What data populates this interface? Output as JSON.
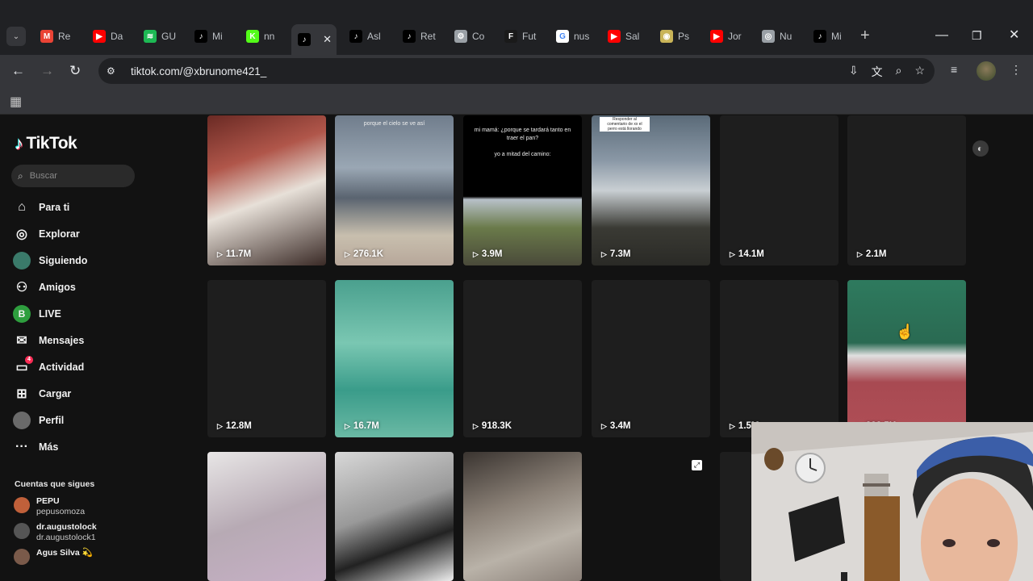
{
  "browser": {
    "tabs": [
      {
        "label": "Re",
        "icon": "gmail-icon",
        "color": "#ea4335",
        "glyph": "M"
      },
      {
        "label": "Da",
        "icon": "youtube-icon",
        "color": "#ff0000",
        "glyph": "▶"
      },
      {
        "label": "GU",
        "icon": "spotify-icon",
        "color": "#1db954",
        "glyph": "≋"
      },
      {
        "label": "Mi",
        "icon": "tiktok-icon",
        "color": "#000000",
        "glyph": "♪"
      },
      {
        "label": "nn",
        "icon": "kick-icon",
        "color": "#53fc18",
        "glyph": "K"
      },
      {
        "label": "",
        "icon": "tiktok-icon",
        "color": "#000000",
        "glyph": "♪",
        "active": true
      },
      {
        "label": "Asl",
        "icon": "tiktok-icon",
        "color": "#000000",
        "glyph": "♪"
      },
      {
        "label": "Ret",
        "icon": "tiktok-icon",
        "color": "#000000",
        "glyph": "♪"
      },
      {
        "label": "Co",
        "icon": "settings-icon",
        "color": "#9aa0a6",
        "glyph": "⚙"
      },
      {
        "label": "Fut",
        "icon": "fifa-icon",
        "color": "#1a1a1a",
        "glyph": "F"
      },
      {
        "label": "nus",
        "icon": "google-icon",
        "color": "#ffffff",
        "glyph": "G"
      },
      {
        "label": "Sal",
        "icon": "youtube-icon",
        "color": "#ff0000",
        "glyph": "▶"
      },
      {
        "label": "Ps",
        "icon": "pes-icon",
        "color": "#c9b458",
        "glyph": "◉"
      },
      {
        "label": "Jor",
        "icon": "youtube-icon",
        "color": "#ff0000",
        "glyph": "▶"
      },
      {
        "label": "Nu",
        "icon": "chrome-icon",
        "color": "#9aa0a6",
        "glyph": "◎"
      },
      {
        "label": "Mi",
        "icon": "tiktok-icon",
        "color": "#000000",
        "glyph": "♪"
      }
    ],
    "url": "tiktok.com/@xbrunome421_"
  },
  "sidebar": {
    "logo_text": "TikTok",
    "search_placeholder": "Buscar",
    "items": [
      {
        "label": "Para ti",
        "icon": "home-icon",
        "glyph": "⌂"
      },
      {
        "label": "Explorar",
        "icon": "compass-icon",
        "glyph": "◎"
      },
      {
        "label": "Siguiendo",
        "icon": "following-avatar-icon",
        "glyph": "●"
      },
      {
        "label": "Amigos",
        "icon": "friends-icon",
        "glyph": "⚇"
      },
      {
        "label": "LIVE",
        "icon": "live-icon",
        "glyph": "B"
      },
      {
        "label": "Mensajes",
        "icon": "messages-icon",
        "glyph": "✉"
      },
      {
        "label": "Actividad",
        "icon": "activity-icon",
        "glyph": "▭",
        "badge": "4"
      },
      {
        "label": "Cargar",
        "icon": "upload-icon",
        "glyph": "⊞"
      },
      {
        "label": "Perfil",
        "icon": "profile-avatar-icon",
        "glyph": "●"
      },
      {
        "label": "Más",
        "icon": "more-icon",
        "glyph": "···"
      }
    ],
    "following_title": "Cuentas que sigues",
    "following": [
      {
        "user": "PEPU",
        "name": "pepusomoza",
        "color": "#c0603a"
      },
      {
        "user": "dr.augustolock",
        "name": "dr.augustolock1",
        "color": "#555555"
      },
      {
        "user": "Agus Silva 💫",
        "name": "",
        "color": "#7a5a4a"
      }
    ]
  },
  "videos": [
    {
      "views": "11.7M",
      "caption": ""
    },
    {
      "views": "276.1K",
      "caption": "porque el cielo se ve así"
    },
    {
      "views": "3.9M",
      "caption": "mi mamá: ¿porque se tardará tanto en traer el pan?\n\nyo a mitad del camino:"
    },
    {
      "views": "7.3M",
      "caption": "Responder al comentario de xx el perro está llorando"
    },
    {
      "views": "14.1M",
      "caption": ""
    },
    {
      "views": "2.1M",
      "caption": ""
    },
    {
      "views": "12.8M",
      "caption": ""
    },
    {
      "views": "16.7M",
      "caption": ""
    },
    {
      "views": "918.3K",
      "caption": ""
    },
    {
      "views": "3.4M",
      "caption": ""
    },
    {
      "views": "1.5M",
      "caption": ""
    },
    {
      "views": "898.5K",
      "caption": ""
    }
  ]
}
